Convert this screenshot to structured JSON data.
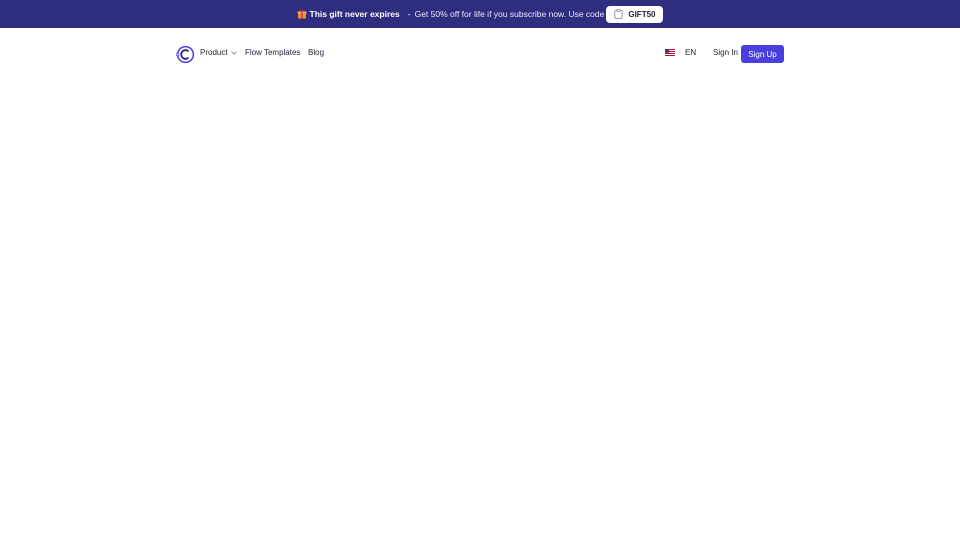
{
  "promo": {
    "headline": "This gift never expires",
    "separator": "-",
    "text": "Get 50% off for life if you subscribe now. Use code",
    "code": "GIFT50",
    "background_color": "#2f2d7d",
    "icon": "gift-icon"
  },
  "nav": {
    "logo_icon": "brand-logo-icon",
    "items": [
      {
        "label": "Product",
        "has_dropdown": true
      },
      {
        "label": "Flow Templates"
      },
      {
        "label": "Blog"
      }
    ],
    "language": {
      "label": "EN",
      "icon": "us-flag-icon"
    },
    "sign_in": "Sign In",
    "sign_up": "Sign Up",
    "accent_color": "#4b3ee0"
  }
}
